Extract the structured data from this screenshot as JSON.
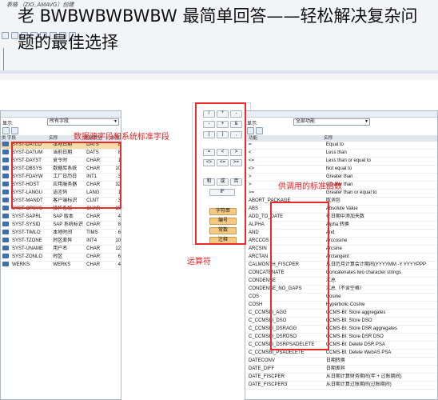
{
  "window": {
    "subtitle": "表格 （ZIO_AMAVG）创建"
  },
  "overlay_title": "老 BWBWBWBWBW 最简单回答——轻松解决复杂问题的最佳选择",
  "left_panel": {
    "display_label": "显示:",
    "display_value": "所有字段",
    "columns": [
      "类型",
      "字段",
      "名称",
      "数据类型",
      "长度"
    ],
    "rows": [
      {
        "field": "SYST-DATLO",
        "name": "本地日期",
        "type": "DATS",
        "len": "8"
      },
      {
        "field": "SYST-DATUM",
        "name": "当前日期",
        "type": "DATS",
        "len": "8"
      },
      {
        "field": "SYST-DAYST",
        "name": "夏令时",
        "type": "CHAR",
        "len": "1"
      },
      {
        "field": "SYST-DBSYS",
        "name": "数据库系统",
        "type": "CHAR",
        "len": "10"
      },
      {
        "field": "SYST-FDAYW",
        "name": "工厂日历日",
        "type": "INT1",
        "len": "3"
      },
      {
        "field": "SYST-HOST",
        "name": "应用服务器",
        "type": "CHAR",
        "len": "32"
      },
      {
        "field": "SYST-LANGU",
        "name": "语言码",
        "type": "LANG",
        "len": "1"
      },
      {
        "field": "SYST-MANDT",
        "name": "客户端标识",
        "type": "CLNT",
        "len": "3"
      },
      {
        "field": "SYST-OPSYS",
        "name": "操作系统",
        "type": "CHAR",
        "len": "10"
      },
      {
        "field": "SYST-SAPRL",
        "name": "SAP 版本",
        "type": "CHAR",
        "len": "4"
      },
      {
        "field": "SYST-SYSID",
        "name": "SAP 系统标识",
        "type": "CHAR",
        "len": "8"
      },
      {
        "field": "SYST-TIMLO",
        "name": "本地时间",
        "type": "TIMS",
        "len": "6"
      },
      {
        "field": "SYST-TZONE",
        "name": "时区差异",
        "type": "INT4",
        "len": "10"
      },
      {
        "field": "SYST-UNAME",
        "name": "用户名",
        "type": "CHAR",
        "len": "12"
      },
      {
        "field": "SYST-ZONLO",
        "name": "时区",
        "type": "CHAR",
        "len": "6"
      },
      {
        "field": "WERKS",
        "name": "WERKS",
        "type": "CHAR",
        "len": "4"
      }
    ]
  },
  "calculator": {
    "row1": [
      "/",
      "*",
      "-"
    ],
    "row2": [
      "-",
      "+",
      "&"
    ],
    "row3": [
      "(",
      ")",
      ","
    ],
    "row4": [
      "=",
      "<",
      ">"
    ],
    "row5": [
      "<>",
      "<=",
      ">="
    ],
    "row6": [
      "和",
      "或",
      "否"
    ],
    "if_label": "IF",
    "text_buttons": [
      "字符串",
      "编号",
      "常数",
      "注释"
    ]
  },
  "right_panel": {
    "display_label": "显示:",
    "display_value": "全部功能",
    "columns": [
      "功能",
      "名称"
    ],
    "rows": [
      {
        "func": "=",
        "name": "Equal to"
      },
      {
        "func": "<",
        "name": "Less than"
      },
      {
        "func": "<=",
        "name": "Less than or equal to"
      },
      {
        "func": "<>",
        "name": "Not equal to"
      },
      {
        "func": ">",
        "name": "Greater than"
      },
      {
        "func": ">",
        "name": "Greater than"
      },
      {
        "func": ">=",
        "name": "Greater than or equal to"
      },
      {
        "func": "ABORT_PACKAGE",
        "name": "取消包"
      },
      {
        "func": "ABS",
        "name": "Absolute Value"
      },
      {
        "func": "ADD_TO_DATE",
        "name": "在日期中添加天数"
      },
      {
        "func": "ALPHA",
        "name": "Alpha 转换"
      },
      {
        "func": "AND",
        "name": "And"
      },
      {
        "func": "ARCCOS",
        "name": "Arccosine"
      },
      {
        "func": "ARCSIN",
        "name": "Arcsine"
      },
      {
        "func": "ARCTAN",
        "name": "Arctangent"
      },
      {
        "func": "CALMONTH_FISCPER",
        "name": "从日历月计算会计期间(YYYYMM -Y YYYYPPP"
      },
      {
        "func": "CONCATENATE",
        "name": "Concatenates two character strings"
      },
      {
        "func": "CONDENSE",
        "name": "汇总"
      },
      {
        "func": "CONDENSE_NO_GAPS",
        "name": "汇总（不含空格）"
      },
      {
        "func": "COS",
        "name": "Cosine"
      },
      {
        "func": "COSH",
        "name": "Hyperbolic Cosine"
      },
      {
        "func": "C_CCMSBI_AGG",
        "name": "CCMS-BI: Store aggregates"
      },
      {
        "func": "C_CCMSBI_DSO",
        "name": "CCMS-BI: Store DSO"
      },
      {
        "func": "C_CCMSBI_DSRAGG",
        "name": "CCMS-BI: Store DSR aggregates"
      },
      {
        "func": "C_CCMSBI_DSRDSO",
        "name": "CCMS-BI: Store DSR DSO"
      },
      {
        "func": "C_CCMSBI_DSRPSADELETE",
        "name": "CCMS-BI: Delete DSR PSA"
      },
      {
        "func": "C_CCMSBI_PSADELETE",
        "name": "CCMS-BI: Delete WebAS PSA"
      },
      {
        "func": "DATECONV",
        "name": "日期转换"
      },
      {
        "func": "DATE_DIFF",
        "name": "日期差异"
      },
      {
        "func": "DATE_FISCPER",
        "name": "从日期计算财务期间(年 + 过账期间)"
      },
      {
        "func": "DATE_FISCPER3",
        "name": "从日期计算过账期间(过账期间)"
      }
    ]
  },
  "annotations": {
    "fields": "数据源字段和系统标准字段",
    "functions": "供调用的标准函数",
    "operators": "运算符"
  }
}
